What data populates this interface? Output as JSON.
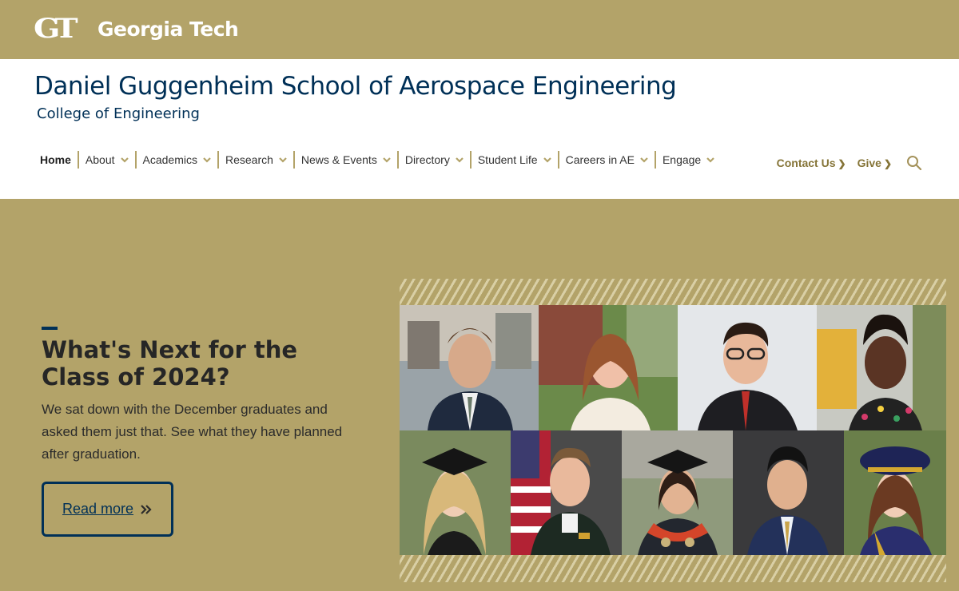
{
  "brand": {
    "mark": "GT",
    "wordmark": "Georgia Tech"
  },
  "header": {
    "title": "Daniel Guggenheim School of Aerospace Engineering",
    "subtitle": "College of Engineering"
  },
  "nav": {
    "items": [
      {
        "label": "Home"
      },
      {
        "label": "About"
      },
      {
        "label": "Academics"
      },
      {
        "label": "Research"
      },
      {
        "label": "News & Events"
      },
      {
        "label": "Directory"
      },
      {
        "label": "Student Life"
      },
      {
        "label": "Careers in AE"
      },
      {
        "label": "Engage"
      }
    ],
    "contact": "Contact Us",
    "give": "Give"
  },
  "hero": {
    "title": "What's Next for the Class of 2024?",
    "text": "We sat down with the December graduates and asked them just that. See what they have planned after graduation.",
    "button": "Read more"
  },
  "colors": {
    "gold": "#B3A369",
    "navy": "#003057",
    "dark_gold": "#857437"
  }
}
